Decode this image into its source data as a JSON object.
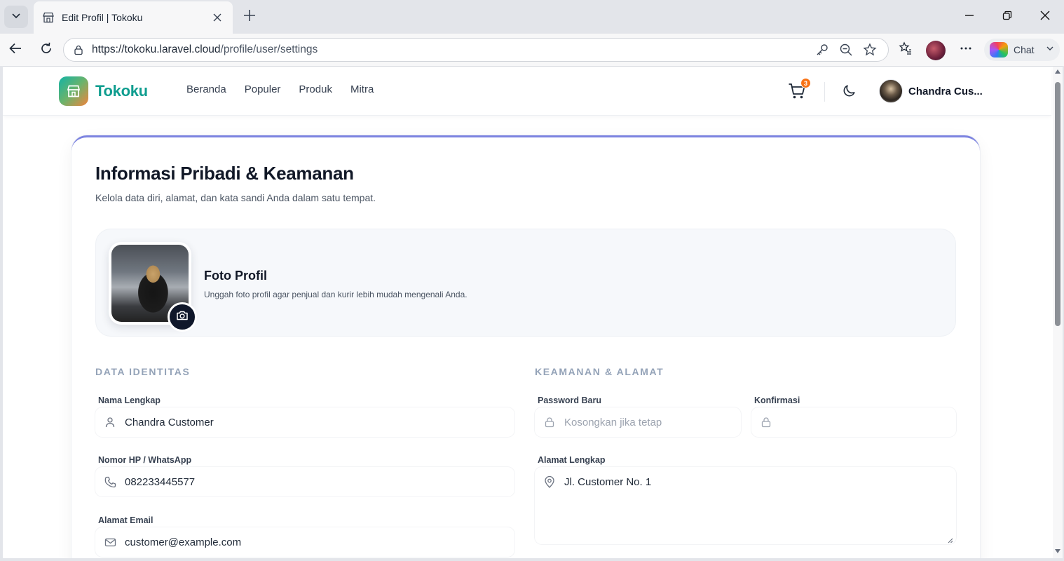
{
  "browser": {
    "tab_title": "Edit Profil | Tokoku",
    "url_host": "https://tokoku.laravel.cloud",
    "url_path": "/profile/user/settings",
    "copilot_label": "Chat"
  },
  "site": {
    "brand": "Tokoku",
    "nav": [
      "Beranda",
      "Populer",
      "Produk",
      "Mitra"
    ],
    "cart_count": "3",
    "user_name": "Chandra Cus..."
  },
  "page": {
    "title": "Informasi Pribadi & Keamanan",
    "subtitle": "Kelola data diri, alamat, dan kata sandi Anda dalam satu tempat."
  },
  "photo": {
    "title": "Foto Profil",
    "description": "Unggah foto profil agar penjual dan kurir lebih mudah mengenali Anda."
  },
  "identity": {
    "heading": "DATA IDENTITAS",
    "name_label": "Nama Lengkap",
    "name_value": "Chandra Customer",
    "phone_label": "Nomor HP / WhatsApp",
    "phone_value": "082233445577",
    "email_label": "Alamat Email",
    "email_value": "customer@example.com"
  },
  "security": {
    "heading": "KEAMANAN & ALAMAT",
    "password_label": "Password Baru",
    "password_placeholder": "Kosongkan jika tetap",
    "confirm_label": "Konfirmasi",
    "confirm_placeholder": "",
    "address_label": "Alamat Lengkap",
    "address_value": "Jl. Customer No. 1"
  },
  "colors": {
    "brand": "#0f9d8f",
    "accent_top_border": "#7c83e0",
    "badge": "#f97316",
    "section_heading": "#94a3b8"
  }
}
